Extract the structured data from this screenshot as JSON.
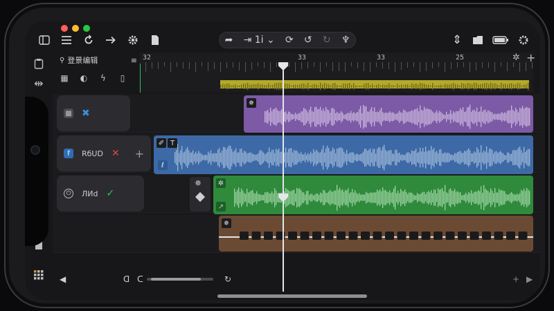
{
  "window": {
    "traffic_colors": [
      "#ff5f57",
      "#febc2e",
      "#28c840"
    ]
  },
  "toolbar": {
    "sidebar_icon": "sidebar-icon",
    "menu_icon": "menu-icon",
    "undo_icon": "undo-icon",
    "share_icon": "share-icon",
    "settings_icon": "gear-icon",
    "doc_icon": "document-icon",
    "transport_label": "⇥ 1i ⌄",
    "right_icons": [
      "split-icon",
      "folder-icon",
      "battery-icon",
      "gear-icon"
    ]
  },
  "header": {
    "edit_label": "登景编辑",
    "menu_glyph": "≡"
  },
  "ruler": {
    "labels": [
      "32",
      "33",
      "33",
      "25"
    ],
    "label_positions_beats": [
      0,
      5,
      9,
      13
    ]
  },
  "tracks": [
    {
      "name": "",
      "color": "#7d5aa6",
      "wave": "#c9b7dd",
      "mute_color": "#3a8fd8"
    },
    {
      "name": "RбUD",
      "color": "#3d6aa6",
      "wave": "#9db7d8",
      "mute_color": "#e04545"
    },
    {
      "name": "ЛИd",
      "color": "#2f8a3c",
      "wave": "#9ed3a3",
      "mute_color": "#2ec655"
    },
    {
      "name": "",
      "color": "#6b4a33",
      "wave": "#1a1a1c",
      "mute_color": ""
    }
  ],
  "footer": {
    "scroll_position": 0.25,
    "scroll_size": 0.75
  }
}
